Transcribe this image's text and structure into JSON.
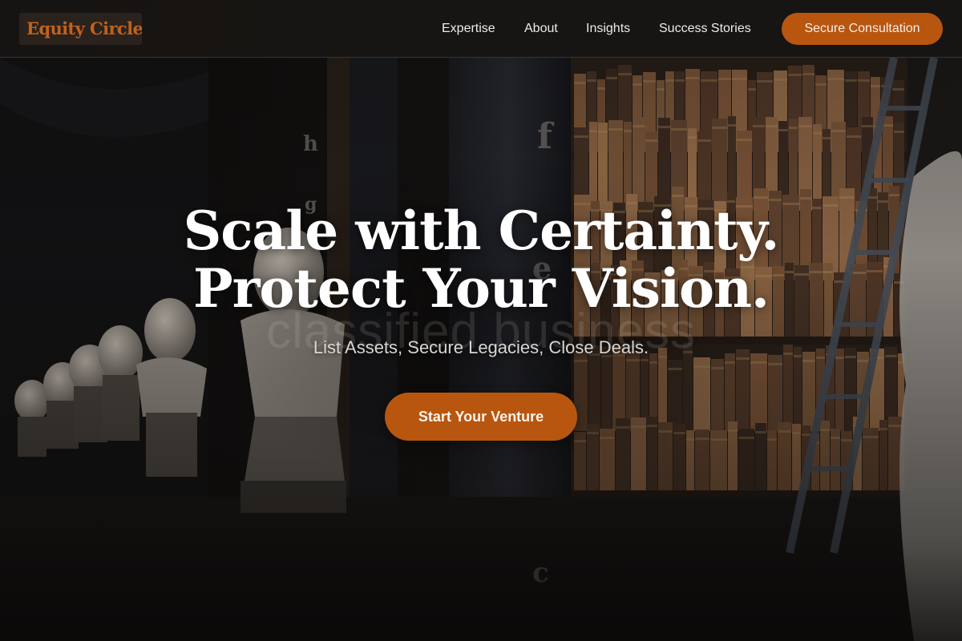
{
  "brand": {
    "name": "Equity Circle"
  },
  "nav": {
    "links": [
      "Expertise",
      "About",
      "Insights",
      "Success Stories"
    ],
    "cta_label": "Secure Consultation"
  },
  "hero": {
    "headline_line1": "Scale with Certainty.",
    "headline_line2": "Protect Your Vision.",
    "ghost_text": "classified business",
    "subheadline": "List Assets, Secure Legacies, Close Deals.",
    "cta_label": "Start Your Venture",
    "background_image": "library-hall-with-busts-and-bookshelves"
  },
  "colors": {
    "accent": "#b8560f",
    "brand_text": "#c0621d",
    "navbar_bg": "#181614"
  }
}
